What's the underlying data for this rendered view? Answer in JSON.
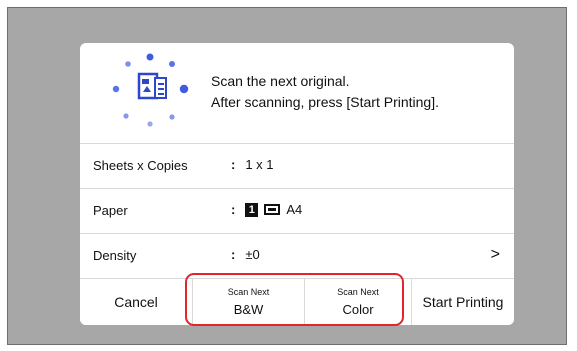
{
  "message": {
    "line1": "Scan the next original.",
    "line2": "After scanning, press [Start Printing]."
  },
  "settings": [
    {
      "label": "Sheets x Copies",
      "value": "1 x 1"
    },
    {
      "label": "Paper",
      "tray_number": "1",
      "value": "A4"
    },
    {
      "label": "Density",
      "value": "±0"
    }
  ],
  "colon": ":",
  "chevron": ">",
  "buttons": {
    "cancel": "Cancel",
    "scan_bw_top": "Scan Next",
    "scan_bw_bottom": "B&W",
    "scan_color_top": "Scan Next",
    "scan_color_bottom": "Color",
    "start": "Start Printing"
  },
  "colors": {
    "background": "#a7a7a7",
    "highlight": "#e0262a",
    "icon_blue": "#3f5be0"
  }
}
